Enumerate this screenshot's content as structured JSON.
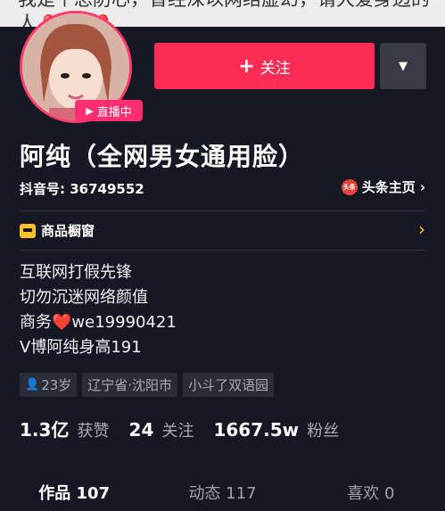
{
  "cover": {
    "text": "我是个总防心，曾经深以网络虚幻，请大爱身边的人",
    "hearts": "❤️❤️❤️"
  },
  "profile": {
    "live_label": "直播中",
    "follow_label": "关注",
    "name": "阿纯（全网男女通用脸）",
    "douyin_id": "抖音号: 36749552",
    "toutiao_label": "头条主页",
    "toutiao_icon_text": "头条"
  },
  "shop": {
    "label": "商品橱窗"
  },
  "bio": {
    "line1": "互联网打假先锋",
    "line2": "切勿沉迷网络颜值",
    "line3_prefix": "商务",
    "line3_suffix": "we19990421",
    "line4": "V博阿纯身高191"
  },
  "tags": {
    "age": "23岁",
    "location": "辽宁省·沈阳市",
    "school": "小斗了双语园"
  },
  "stats": {
    "likes_num": "1.3亿",
    "likes_label": "获赞",
    "following_num": "24",
    "following_label": "关注",
    "fans_num": "1667.5w",
    "fans_label": "粉丝"
  },
  "tabs": {
    "works": "作品 107",
    "dynamics": "动态 117",
    "likes": "喜欢 0"
  }
}
